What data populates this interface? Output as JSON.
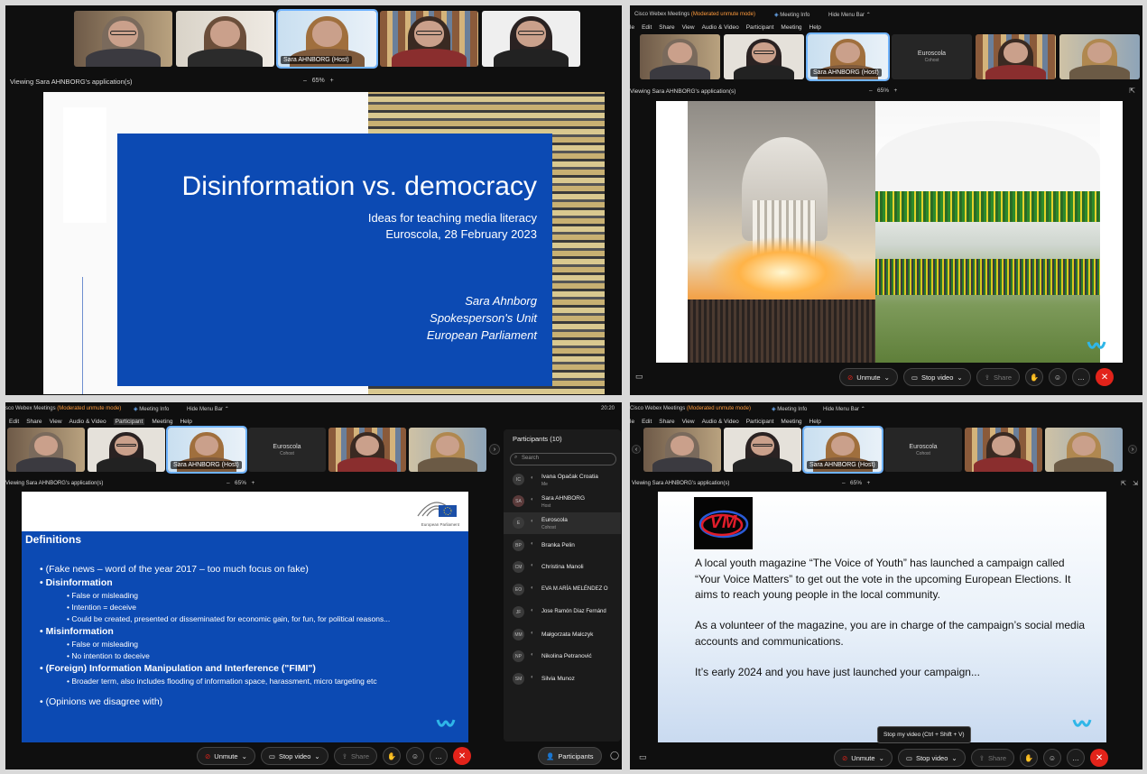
{
  "q1": {
    "participants": [
      {
        "name": ""
      },
      {
        "name": ""
      },
      {
        "name": "Sara AHNBORG (Host)"
      },
      {
        "name": ""
      },
      {
        "name": ""
      }
    ],
    "viewing": "Viewing Sara AHNBORG's application(s)",
    "zoom": "65%",
    "slide": {
      "title": "Disinformation vs. democracy",
      "subtitle1": "Ideas for teaching media literacy",
      "subtitle2": "Euroscola, 28 February 2023",
      "author1": "Sara Ahnborg",
      "author2": "Spokesperson's Unit",
      "author3": "European Parliament"
    }
  },
  "q2": {
    "app_title": "Cisco Webex Meetings",
    "mode": "(Moderated unmute mode)",
    "meeting_info": "Meeting Info",
    "hide_menu": "Hide Menu Bar",
    "menu": [
      "le",
      "Edit",
      "Share",
      "View",
      "Audio & Video",
      "Participant",
      "Meeting",
      "Help"
    ],
    "tiles": [
      {
        "name": ""
      },
      {
        "name": ""
      },
      {
        "name": "Sara AHNBORG (Host)"
      },
      {
        "name": "Euroscola",
        "role": "Cohost"
      },
      {
        "name": ""
      },
      {
        "name": ""
      }
    ],
    "viewing": "Viewing Sara AHNBORG's application(s)",
    "zoom": "65%",
    "controls": {
      "unmute": "Unmute",
      "stop_video": "Stop video",
      "share": "Share"
    }
  },
  "q3": {
    "app_title": "sco Webex Meetings",
    "mode": "(Moderated unmute mode)",
    "meeting_info": "Meeting Info",
    "hide_menu": "Hide Menu Bar",
    "clock": "20:20",
    "menu": [
      "Edit",
      "Share",
      "View",
      "Audio & Video",
      "Participant",
      "Meeting",
      "Help"
    ],
    "tiles": [
      {
        "name": ""
      },
      {
        "name": ""
      },
      {
        "name": "Sara AHNBORG (Host)"
      },
      {
        "name": "Euroscola",
        "role": "Cohost"
      },
      {
        "name": ""
      },
      {
        "name": ""
      }
    ],
    "viewing": "Viewing Sara AHNBORG's application(s)",
    "zoom": "65%",
    "slide": {
      "logo_text": "European Parliament",
      "heading": "Definitions",
      "l1": "• (Fake news – word of the year 2017 – too much focus on fake)",
      "l2": "• Disinformation",
      "l3": "• False or misleading",
      "l4": "• Intention = deceive",
      "l5": "• Could be created, presented or disseminated for economic gain, for fun, for political reasons...",
      "l6": "• Misinformation",
      "l7": "• False or misleading",
      "l8": "• No intention to deceive",
      "l9": "• (Foreign) Information Manipulation and Interference (\"FIMI\")",
      "l10": "• Broader term, also includes flooding of information space, harassment, micro targeting etc",
      "l11": "• (Opinions we disagree with)"
    },
    "participants_panel": {
      "header": "Participants (10)",
      "search_placeholder": "Search",
      "people": [
        {
          "initials": "IC",
          "name": "Ivana Opačak Croatia",
          "role": "Me"
        },
        {
          "initials": "SA",
          "name": "Sara AHNBORG",
          "role": "Host"
        },
        {
          "initials": "E",
          "name": "Euroscola",
          "role": "Cohost"
        },
        {
          "initials": "BP",
          "name": "Branka Pelin",
          "role": ""
        },
        {
          "initials": "CM",
          "name": "Christina Manoli",
          "role": ""
        },
        {
          "initials": "EO",
          "name": "EVA M ARÍA MELÉNDEZ O",
          "role": ""
        },
        {
          "initials": "JF",
          "name": "Jose Ramón Díaz Fernánd",
          "role": ""
        },
        {
          "initials": "MM",
          "name": "Małgorzata Malczyk",
          "role": ""
        },
        {
          "initials": "NP",
          "name": "Nikolina Petranović",
          "role": ""
        },
        {
          "initials": "SM",
          "name": "Silvia Munoz",
          "role": ""
        }
      ]
    },
    "controls": {
      "unmute": "Unmute",
      "stop_video": "Stop video",
      "share": "Share",
      "participants": "Participants"
    }
  },
  "q4": {
    "app_title": "Cisco Webex Meetings",
    "mode": "(Moderated unmute mode)",
    "meeting_info": "Meeting Info",
    "hide_menu": "Hide Menu Bar",
    "menu": [
      "le",
      "Edit",
      "Share",
      "View",
      "Audio & Video",
      "Participant",
      "Meeting",
      "Help"
    ],
    "tiles": [
      {
        "name": ""
      },
      {
        "name": ""
      },
      {
        "name": "Sara AHNBORG (Host)"
      },
      {
        "name": "Euroscola",
        "role": "Cohost"
      },
      {
        "name": ""
      },
      {
        "name": ""
      }
    ],
    "viewing": "Viewing Sara AHNBORG's application(s)",
    "zoom": "65%",
    "slide": {
      "logo": "VM",
      "p1": "A local youth magazine “The Voice of Youth” has launched a campaign called “Your Voice Matters” to get out the vote in the upcoming European Elections. It aims to reach young people in the local community.",
      "p2": "As a volunteer of the magazine, you are in charge of the campaign’s social media accounts and communications.",
      "p3": "It’s early 2024 and you have just launched your campaign..."
    },
    "tooltip": "Stop my video (Ctrl + Shift + V)",
    "controls": {
      "unmute": "Unmute",
      "stop_video": "Stop video",
      "share": "Share"
    }
  }
}
